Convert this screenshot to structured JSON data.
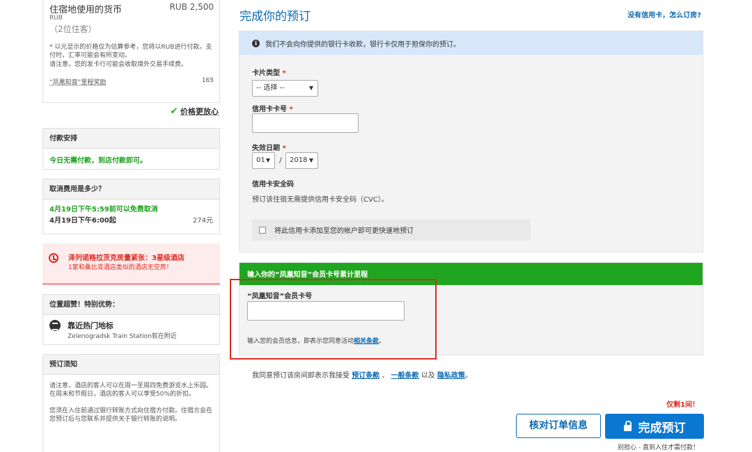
{
  "summary": {
    "currency_label": "住宿地使用的货币",
    "currency_amount": "RUB 2,500",
    "currency_code": "RUB",
    "guests": "（2位住客）",
    "note1": "* 以元显示的价格仅为估算参考，您将以RUB进行付款。支付时，汇率可能会有所变动。",
    "note2": "请注意，您的发卡行可能会收取境外交易手续费。",
    "reward_label": "“凤凰知音”里程奖励",
    "reward_value": "165",
    "price_assured": "价格更放心"
  },
  "payment": {
    "title": "付款安排",
    "text": "今日无需付款，到店付款即可。"
  },
  "cancellation": {
    "title": "取消费用是多少？",
    "free_until": "4月19日下午5:59前可以免费取消",
    "from_label": "4月19日下午6:00起",
    "fee": "274元"
  },
  "alert": {
    "line1": "泽列诺格拉茨克房量紧张：3星级酒店",
    "line2": "1家和桑比亚酒店类似的酒店无空房！"
  },
  "location": {
    "title": "位置超赞！特别优势：",
    "landmark_title": "靠近热门地标",
    "landmark_sub": "Zelenogradsk Train Station就在附近"
  },
  "notice": {
    "title": "预订须知",
    "p1": "请注意，酒店的客人可以在周一至周四免费游览水上乐园。在周末和节假日，酒店的客人可以享受50%的折扣。",
    "p2": "您须在入住前通过银行转账方式向住宿方付款。住宿方会在您预订后与您联系并提供关于银行转账的说明。"
  },
  "form": {
    "title": "完成你的预订",
    "no_card_link": "没有信用卡，怎么订房?",
    "info": "我们不会向你提供的银行卡收款，银行卡仅用于担保你的预订。",
    "card_type_label": "卡片类型",
    "card_type_value": "-- 选择 --",
    "card_number_label": "信用卡卡号",
    "expiry_label": "失效日期",
    "expiry_month": "01",
    "expiry_sep": "/",
    "expiry_year": "2018",
    "cvc_label": "信用卡安全码",
    "cvc_note": "预订该住宿无需提供信用卡安全码（CVC）。",
    "save_card": "将此信用卡添加至您的帐户即可更快速地预订",
    "required_mark": "*"
  },
  "member": {
    "header": "输入你的“凤凰知音”会员卡号累计里程",
    "label": "“凤凰知音”会员卡号",
    "note_prefix": "输入您的会员信息，即表示您同意活动",
    "note_link": "相关条款",
    "note_suffix": "。"
  },
  "agreement": {
    "prefix": "我同意预订该房间即表示我接受",
    "link1": "预订条款",
    "sep1": "、",
    "link2": "一般条款",
    "sep2": "以及",
    "link3": "隐私政策",
    "suffix": "。"
  },
  "actions": {
    "rooms_left": "仅剩1间！",
    "review_label": "核对订单信息",
    "complete_label": "完成预订",
    "pay_later": "别担心 - 直到入住才需付款！"
  },
  "colors": {
    "link_blue": "#0a69b4",
    "green": "#1fa51f",
    "red": "#e0281e",
    "button_blue": "#0a78d0"
  }
}
